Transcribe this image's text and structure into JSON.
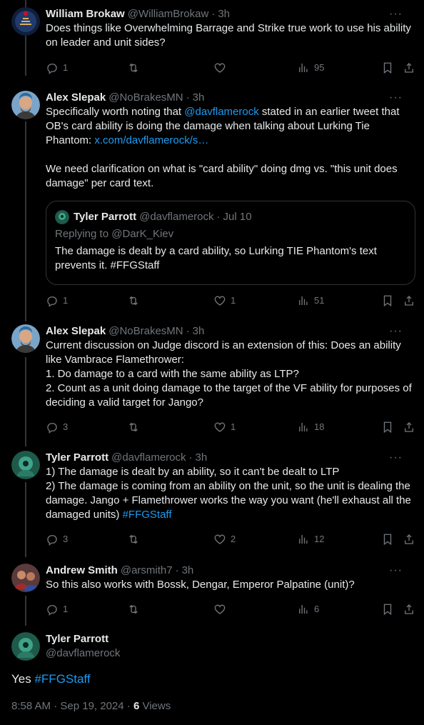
{
  "tweets": [
    {
      "name": "William Brokaw",
      "handle": "@WilliamBrokaw",
      "time": "3h",
      "text": "Does things like Overwhelming Barrage and Strike true work to use his ability on leader and unit sides?",
      "replies": "1",
      "retweets": "",
      "likes": "",
      "views": "95"
    },
    {
      "name": "Alex Slepak",
      "handle": "@NoBrakesMN",
      "time": "3h",
      "text_a": "Specifically worth noting that ",
      "mention": "@davflamerock",
      "text_b": " stated in an earlier tweet that OB's card ability is doing the damage when talking about Lurking Tie Phantom: ",
      "url": "x.com/davflamerock/s…",
      "text_c": "We need clarification on what is \"card ability\" doing dmg vs. \"this unit does damage\" per card text.",
      "quote": {
        "name": "Tyler Parrott",
        "handle": "@davflamerock",
        "date": "Jul 10",
        "replying_to": "Replying to @DarK_Kiev",
        "text": "The damage is dealt by a card ability, so Lurking TIE Phantom's text prevents it. #FFGStaff"
      },
      "replies": "1",
      "retweets": "",
      "likes": "1",
      "views": "51"
    },
    {
      "name": "Alex Slepak",
      "handle": "@NoBrakesMN",
      "time": "3h",
      "lines": [
        "Current discussion on Judge discord is an extension of this: Does an ability like Vambrace Flamethrower:",
        "1. Do damage to a card with the same ability as LTP?",
        "2. Count as a unit doing damage to the target of the VF ability for purposes of deciding a valid target for Jango?"
      ],
      "replies": "3",
      "retweets": "",
      "likes": "1",
      "views": "18"
    },
    {
      "name": "Tyler Parrott",
      "handle": "@davflamerock",
      "time": "3h",
      "line1": "1) The damage is dealt by an ability, so it can't be dealt to LTP",
      "line2": "2) The damage is coming from an ability on the unit, so the unit is dealing the damage. Jango + Flamethrower works the way you want (he'll exhaust all the damaged units) ",
      "hashtag": "#FFGStaff",
      "replies": "3",
      "retweets": "",
      "likes": "2",
      "views": "12"
    },
    {
      "name": "Andrew Smith",
      "handle": "@arsmith7",
      "time": "3h",
      "text": "So this also works with Bossk, Dengar, Emperor Palpatine (unit)?",
      "replies": "1",
      "retweets": "",
      "likes": "",
      "views": "6"
    }
  ],
  "main": {
    "name": "Tyler Parrott",
    "handle": "@davflamerock",
    "text": "Yes ",
    "hashtag": "#FFGStaff",
    "timestamp": "8:58 AM · Sep 19, 2024 · ",
    "views_count": "6",
    "views_label": " Views"
  },
  "ui": {
    "more": "···",
    "sep": "·"
  },
  "colors": {
    "background": "#000000",
    "text": "#e7e9ea",
    "muted": "#71767b",
    "link": "#1d9bf0",
    "border": "#2f3336"
  }
}
